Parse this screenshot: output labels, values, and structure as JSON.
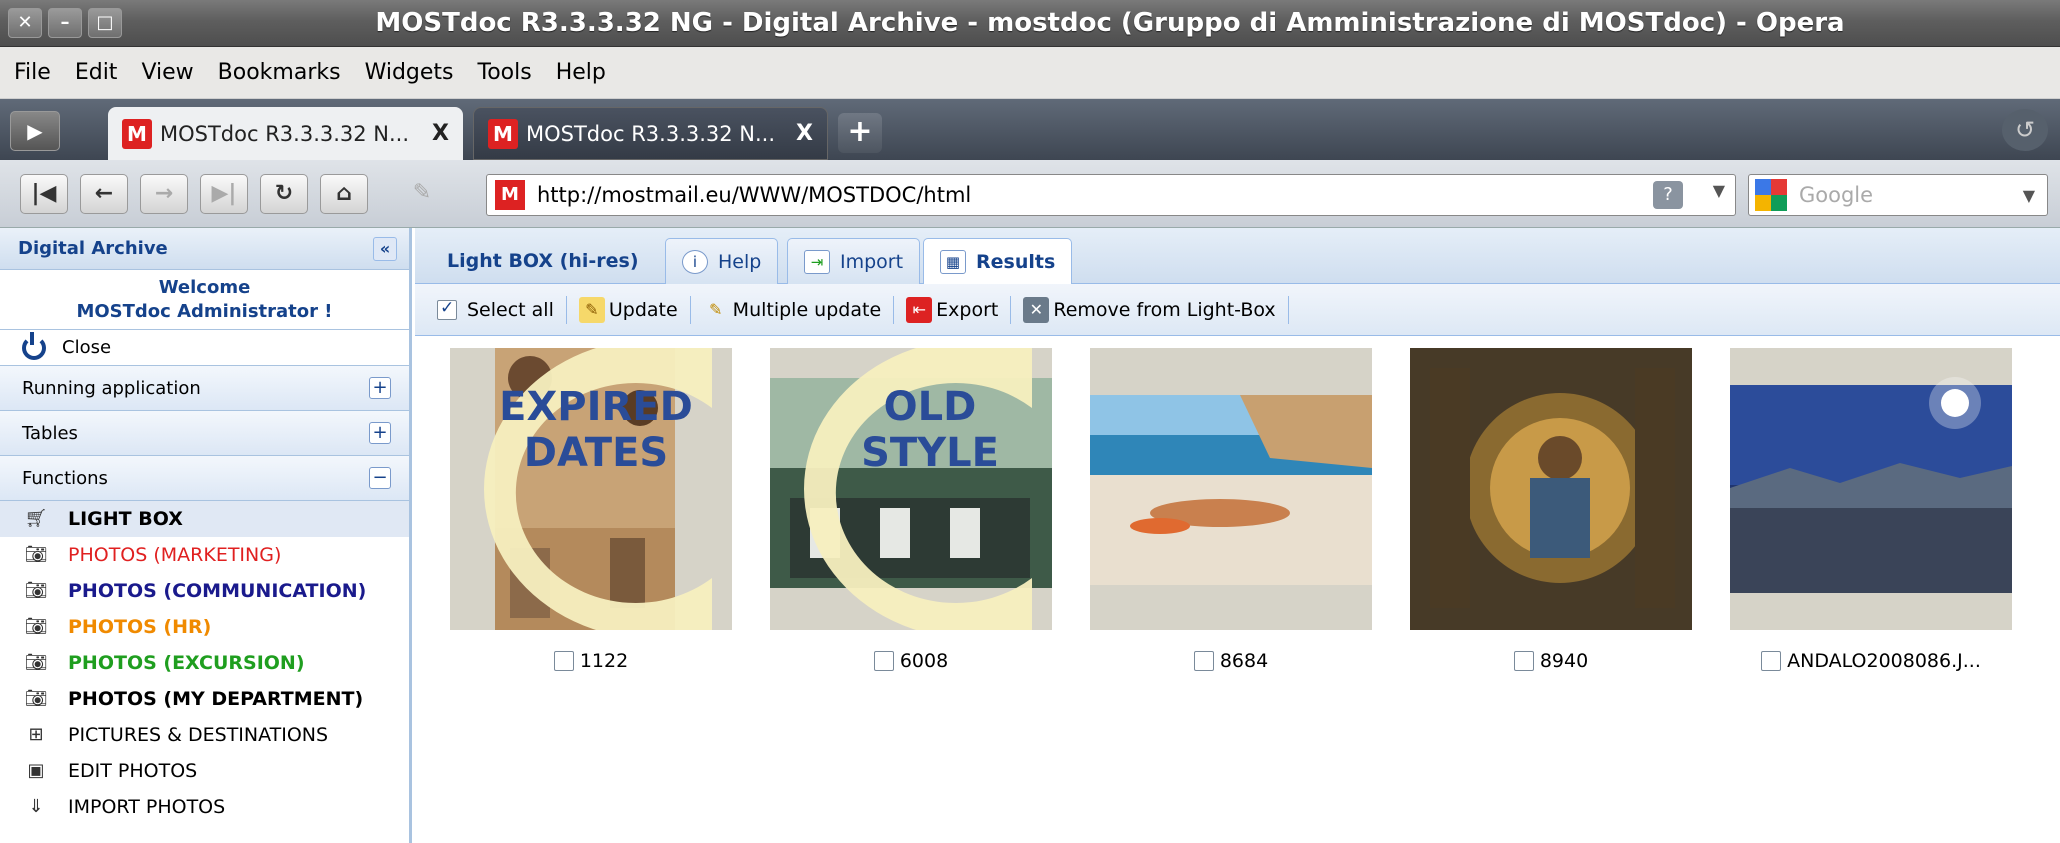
{
  "window": {
    "title": "MOSTdoc R3.3.3.32 NG - Digital Archive - mostdoc (Gruppo di Amministrazione di MOSTdoc) - Opera"
  },
  "menu": [
    "File",
    "Edit",
    "View",
    "Bookmarks",
    "Widgets",
    "Tools",
    "Help"
  ],
  "tabs": [
    {
      "title": "MOSTdoc R3.3.3.32 N...",
      "close": "X"
    },
    {
      "title": "MOSTdoc R3.3.3.32 N...",
      "close": "X"
    }
  ],
  "address": {
    "url": "http://mostmail.eu/WWW/MOSTDOC/html",
    "search_placeholder": "Google"
  },
  "sidebar": {
    "title": "Digital Archive",
    "welcome_line1": "Welcome",
    "welcome_line2": "MOSTdoc Administrator !",
    "close_label": "Close",
    "sections": [
      {
        "label": "Running application",
        "tool": "+"
      },
      {
        "label": "Tables",
        "tool": "+"
      },
      {
        "label": "Functions",
        "tool": "−"
      }
    ],
    "functions": [
      {
        "label": "LIGHT BOX",
        "color": "#000000",
        "bold": true
      },
      {
        "label": "PHOTOS (MARKETING)",
        "color": "#e02020",
        "bold": false
      },
      {
        "label": "PHOTOS (COMMUNICATION)",
        "color": "#1a1a8c",
        "bold": true
      },
      {
        "label": "PHOTOS (HR)",
        "color": "#f08a00",
        "bold": true
      },
      {
        "label": "PHOTOS (EXCURSION)",
        "color": "#1f9e1f",
        "bold": true
      },
      {
        "label": "PHOTOS (MY DEPARTMENT)",
        "color": "#000000",
        "bold": true
      },
      {
        "label": "PICTURES & DESTINATIONS",
        "color": "#000000",
        "bold": false
      },
      {
        "label": "EDIT PHOTOS",
        "color": "#000000",
        "bold": false
      },
      {
        "label": "IMPORT PHOTOS",
        "color": "#000000",
        "bold": false
      }
    ]
  },
  "panel": {
    "tabs": {
      "lightbox": "Light BOX (hi-res)",
      "help": "Help",
      "import": "Import",
      "results": "Results"
    },
    "toolbar": {
      "select_all": "Select all",
      "update": "Update",
      "multiple_update": "Multiple update",
      "export": "Export",
      "remove": "Remove from Light-Box"
    },
    "overlays": {
      "expired1": "EXPIRED",
      "expired2": "DATES",
      "old1": "OLD",
      "old2": "STYLE"
    },
    "items": [
      {
        "label": "1122"
      },
      {
        "label": "6008"
      },
      {
        "label": "8684"
      },
      {
        "label": "8940"
      },
      {
        "label": "ANDALO2008086.J..."
      }
    ]
  },
  "colors": {
    "accent": "#15428b",
    "panel_border": "#99bbe8"
  }
}
